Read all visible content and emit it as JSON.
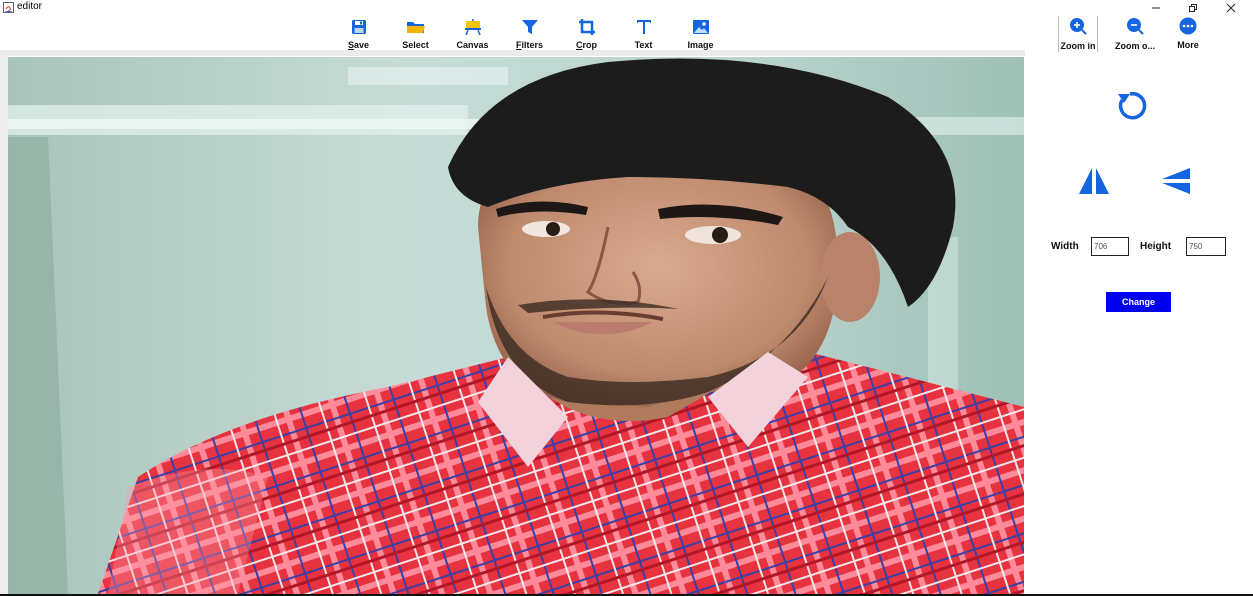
{
  "window": {
    "title": "editor"
  },
  "toolbar": {
    "items": [
      {
        "label": "ave",
        "mnemonic": "S",
        "icon": "save-icon"
      },
      {
        "label": "Select",
        "icon": "select-folder-icon"
      },
      {
        "label": "Canvas",
        "icon": "canvas-easel-icon"
      },
      {
        "label": "ilters",
        "mnemonic": "F",
        "icon": "filter-funnel-icon"
      },
      {
        "label": "rop",
        "mnemonic": "C",
        "icon": "crop-icon"
      },
      {
        "label": "Text",
        "icon": "text-t-icon"
      },
      {
        "label": "Image",
        "icon": "image-icon"
      }
    ]
  },
  "right_toolbar": {
    "zoom_in": "Zoom in",
    "zoom_out": "Zoom o...",
    "more": "More"
  },
  "side_panel": {
    "width_label": "Width",
    "width_value": "706",
    "height_label": "Height",
    "height_value": "750",
    "change_label": "Change"
  },
  "colors": {
    "accent": "#1565e0",
    "change_button": "#0000ee"
  }
}
